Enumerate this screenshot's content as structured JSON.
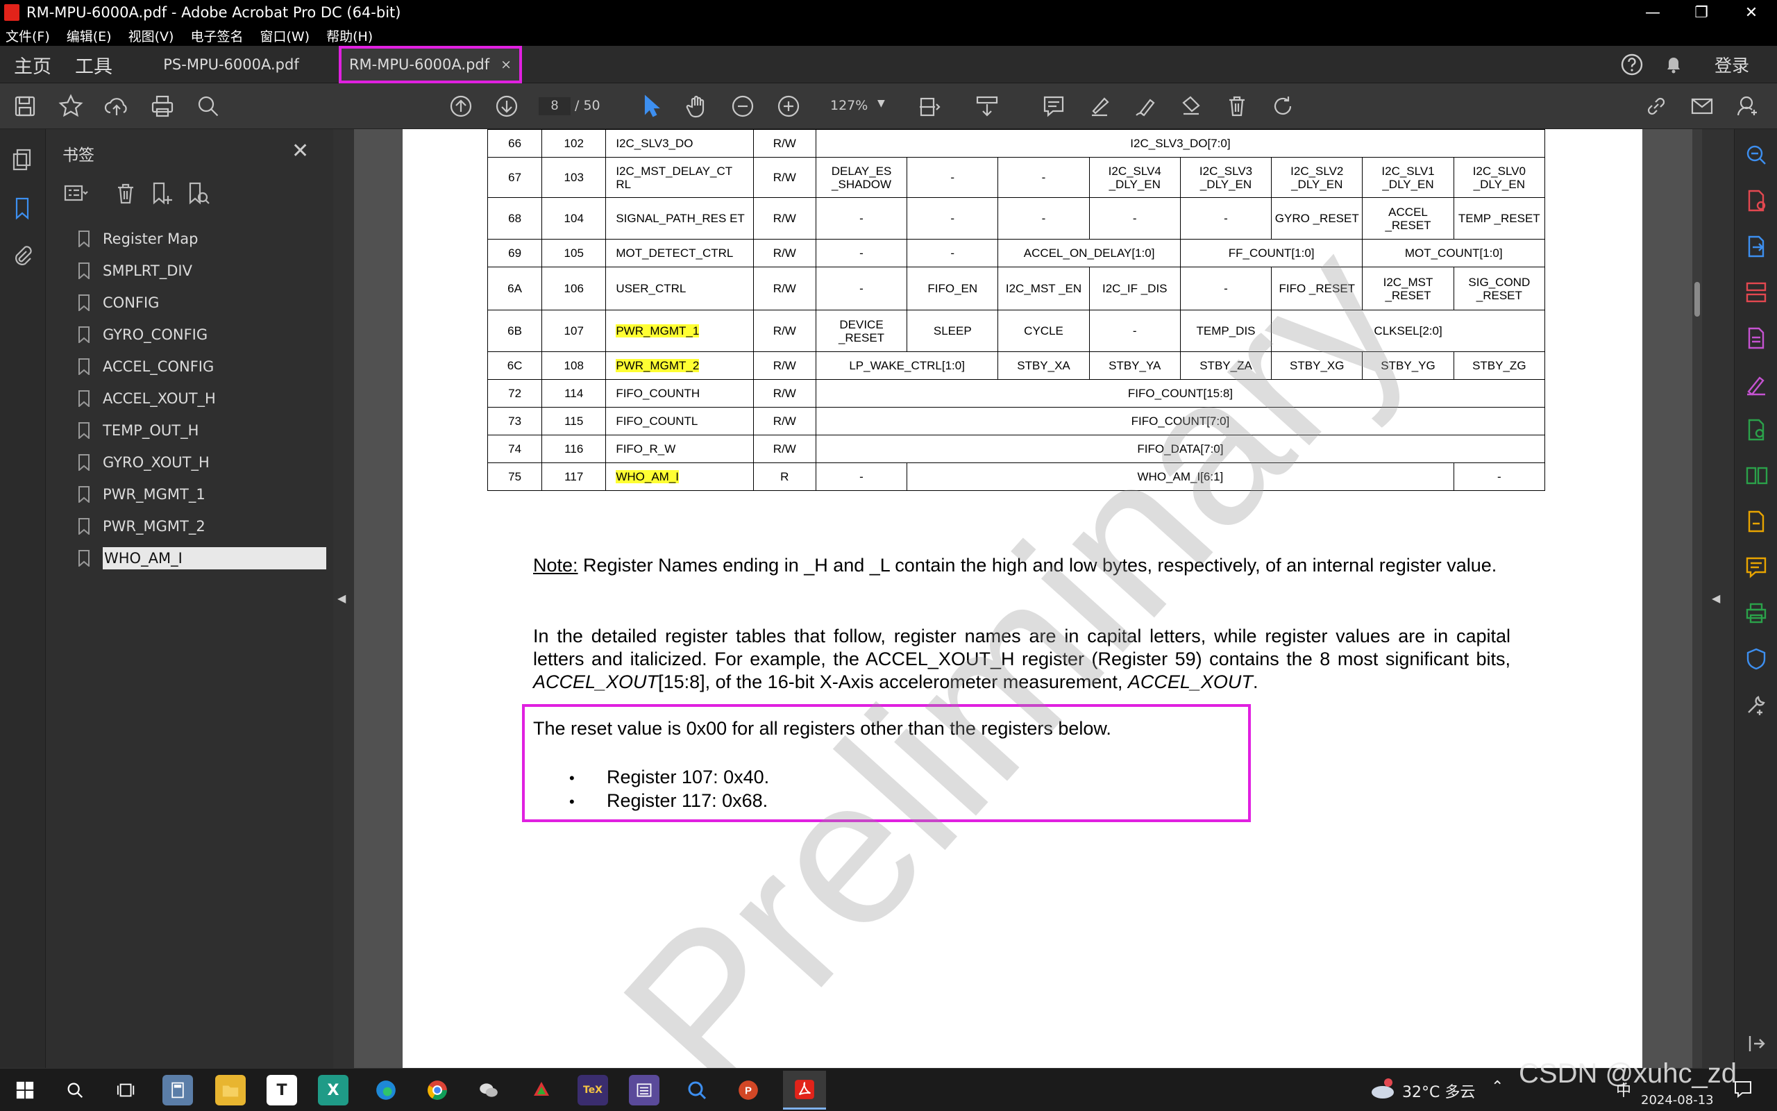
{
  "window": {
    "title": "RM-MPU-6000A.pdf - Adobe Acrobat Pro DC (64-bit)"
  },
  "menu": [
    "文件(F)",
    "编辑(E)",
    "视图(V)",
    "电子签名",
    "窗口(W)",
    "帮助(H)"
  ],
  "tabs": {
    "home": "主页",
    "tools": "工具",
    "docs": [
      {
        "label": "PS-MPU-6000A.pdf",
        "active": false
      },
      {
        "label": "RM-MPU-6000A.pdf",
        "active": true
      }
    ],
    "close_glyph": "×",
    "signin": "登录"
  },
  "toolbar": {
    "page_current": "8",
    "page_total": "/ 50",
    "zoom": "127%"
  },
  "bookmarks": {
    "title": "书签",
    "items": [
      "Register Map",
      "SMPLRT_DIV",
      "CONFIG",
      "GYRO_CONFIG",
      "ACCEL_CONFIG",
      "ACCEL_XOUT_H",
      "TEMP_OUT_H",
      "GYRO_XOUT_H",
      "PWR_MGMT_1",
      "PWR_MGMT_2",
      "WHO_AM_I"
    ],
    "selected": "WHO_AM_I"
  },
  "doc": {
    "watermark": "Preliminary",
    "rows": [
      {
        "hex": "66",
        "dec": "102",
        "name": "I2C_SLV3_DO",
        "rw": "R/W",
        "span": "I2C_SLV3_DO[7:0]"
      },
      {
        "hex": "67",
        "dec": "103",
        "name": "I2C_MST_DELAY_CT RL",
        "rw": "R/W",
        "bits": [
          "DELAY_ES _SHADOW",
          "-",
          "-",
          "I2C_SLV4 _DLY_EN",
          "I2C_SLV3 _DLY_EN",
          "I2C_SLV2 _DLY_EN",
          "I2C_SLV1 _DLY_EN",
          "I2C_SLV0 _DLY_EN"
        ]
      },
      {
        "hex": "68",
        "dec": "104",
        "name": "SIGNAL_PATH_RES ET",
        "rw": "R/W",
        "bits": [
          "-",
          "-",
          "-",
          "-",
          "-",
          "GYRO _RESET",
          "ACCEL _RESET",
          "TEMP _RESET"
        ]
      },
      {
        "hex": "69",
        "dec": "105",
        "name": "MOT_DETECT_CTRL",
        "rw": "R/W",
        "c1": "-",
        "c2": "-",
        "c34": "ACCEL_ON_DELAY[1:0]",
        "c56": "FF_COUNT[1:0]",
        "c78": "MOT_COUNT[1:0]"
      },
      {
        "hex": "6A",
        "dec": "106",
        "name": "USER_CTRL",
        "rw": "R/W",
        "bits": [
          "-",
          "FIFO_EN",
          "I2C_MST _EN",
          "I2C_IF _DIS",
          "-",
          "FIFO _RESET",
          "I2C_MST _RESET",
          "SIG_COND _RESET"
        ]
      },
      {
        "hex": "6B",
        "dec": "107",
        "name": "PWR_MGMT_1",
        "rw": "R/W",
        "b1": "DEVICE _RESET",
        "b2": "SLEEP",
        "b3": "CYCLE",
        "b4": "-",
        "b5": "TEMP_DIS",
        "b678": "CLKSEL[2:0]"
      },
      {
        "hex": "6C",
        "dec": "108",
        "name": "PWR_MGMT_2",
        "rw": "R/W",
        "b12": "LP_WAKE_CTRL[1:0]",
        "b3": "STBY_XA",
        "b4": "STBY_YA",
        "b5": "STBY_ZA",
        "b6": "STBY_XG",
        "b7": "STBY_YG",
        "b8": "STBY_ZG"
      },
      {
        "hex": "72",
        "dec": "114",
        "name": "FIFO_COUNTH",
        "rw": "R/W",
        "span": "FIFO_COUNT[15:8]"
      },
      {
        "hex": "73",
        "dec": "115",
        "name": "FIFO_COUNTL",
        "rw": "R/W",
        "span": "FIFO_COUNT[7:0]"
      },
      {
        "hex": "74",
        "dec": "116",
        "name": "FIFO_R_W",
        "rw": "R/W",
        "span": "FIFO_DATA[7:0]"
      },
      {
        "hex": "75",
        "dec": "117",
        "name": "WHO_AM_I",
        "rw": "R",
        "b1": "-",
        "mid": "WHO_AM_I[6:1]",
        "b8": "-"
      }
    ],
    "note_label": "Note:",
    "note_text": " Register Names ending in _H and _L contain the high and low bytes, respectively, of an internal register value.",
    "para2_a": "In the detailed register tables that follow, register names are in capital letters, while register values are in capital letters and italicized.  For example, the ACCEL_XOUT_H register (Register 59) contains the 8 most significant bits, ",
    "para2_i1": "ACCEL_XOUT",
    "para2_b": "[15:8], of the 16-bit X-Axis accelerometer measurement, ",
    "para2_i2": "ACCEL_XOUT",
    "para2_c": ".",
    "reset_text": "The reset value is 0x00 for all registers other than the registers below.",
    "bullets": [
      "Register 107: 0x40.",
      "Register 117: 0x68."
    ],
    "bullet_glyph": "•"
  },
  "taskbar": {
    "weather": "32°C 多云",
    "ime": "中",
    "date": "2024-08-13",
    "watermark": "CSDN @xuhc_zd"
  }
}
